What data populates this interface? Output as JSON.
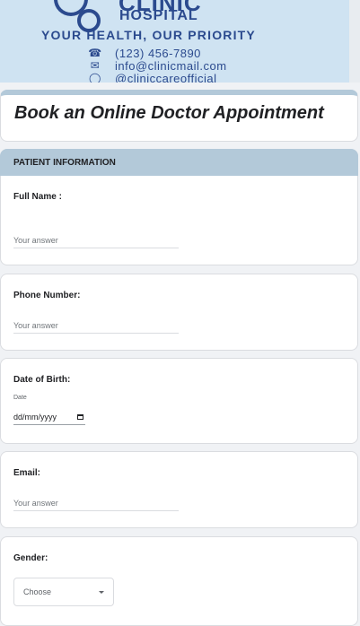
{
  "banner": {
    "brand_top": "CLINIC",
    "brand_sub": "HOSPITAL",
    "slogan": "YOUR HEALTH, OUR PRIORITY",
    "phone": "(123) 456-7890",
    "email": "info@clinicmail.com",
    "social": "@cliniccareofficial"
  },
  "form": {
    "title": "Book an Online Doctor Appointment",
    "section": "PATIENT INFORMATION",
    "questions": {
      "full_name": {
        "label": "Full Name :",
        "placeholder": "Your answer"
      },
      "phone": {
        "label": "Phone Number:",
        "placeholder": "Your answer"
      },
      "dob": {
        "label": "Date of Birth:",
        "sublabel": "Date",
        "value": "dd/mm/yyyy"
      },
      "email": {
        "label": "Email:",
        "placeholder": "Your answer"
      },
      "gender": {
        "label": "Gender:",
        "selected": "Choose"
      }
    }
  },
  "colors": {
    "brand": "#2b4a8e",
    "header": "#b3c9d9",
    "banner_bg": "#cfe3f2"
  }
}
